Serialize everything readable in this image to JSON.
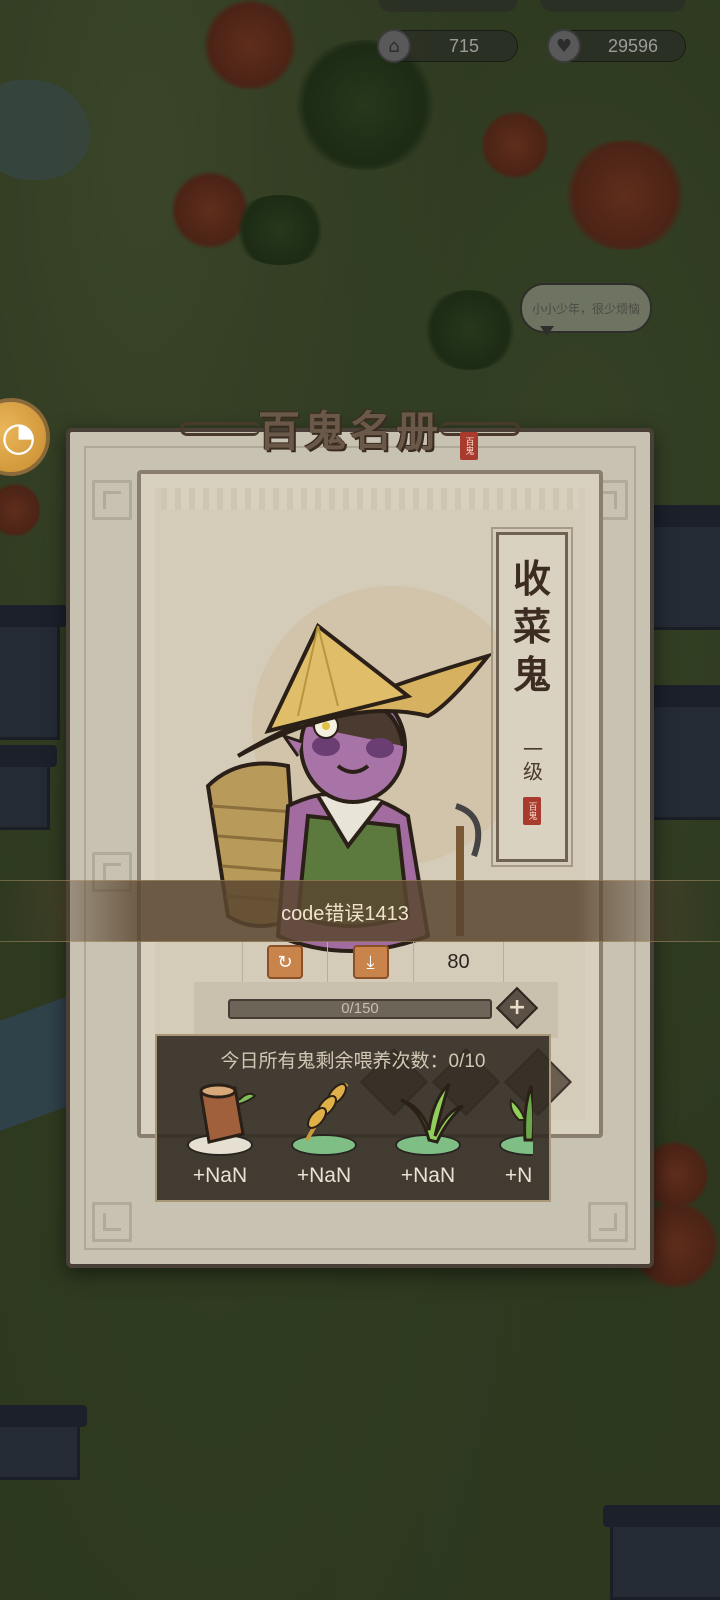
{
  "hud": {
    "building_value": "715",
    "heart_value": "29596"
  },
  "speech_bubble": "小小少年，很少烦恼",
  "panel": {
    "title": "百鬼名册",
    "seal": "百鬼"
  },
  "character": {
    "name_chars": [
      "收",
      "菜",
      "鬼"
    ],
    "level": "一级",
    "seal": "百鬼"
  },
  "stats": {
    "value": "80"
  },
  "exp": {
    "text": "0/150",
    "progress": 0
  },
  "error_message": "code错误1413",
  "feed": {
    "title": "今日所有鬼剩余喂养次数：0/10",
    "items": [
      {
        "icon": "wood-stump-icon",
        "value": "+NaN"
      },
      {
        "icon": "wheat-icon",
        "value": "+NaN"
      },
      {
        "icon": "grass-icon",
        "value": "+NaN"
      },
      {
        "icon": "sprout-icon",
        "value": "+NaN"
      }
    ]
  },
  "colors": {
    "panel_bg": "#c8c2b3",
    "popup_bg": "#322c24",
    "accent_orange": "#c9844c"
  }
}
